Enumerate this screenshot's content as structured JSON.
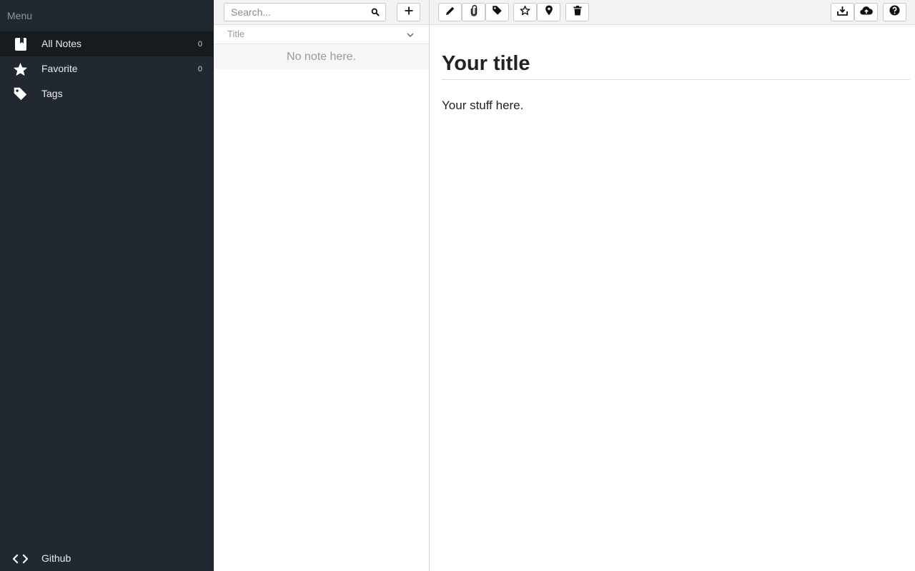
{
  "sidebar": {
    "menu_label": "Menu",
    "items": [
      {
        "label": "All Notes",
        "count": "0",
        "icon": "notebook-icon"
      },
      {
        "label": "Favorite",
        "count": "0",
        "icon": "star-icon"
      },
      {
        "label": "Tags",
        "icon": "tag-icon"
      }
    ],
    "bottom_item": {
      "label": "Github",
      "icon": "code-icon"
    }
  },
  "list": {
    "search_placeholder": "Search...",
    "sort_label": "Title",
    "empty_message": "No note here."
  },
  "editor": {
    "title_placeholder": "Your title",
    "body_placeholder": "Your stuff here."
  },
  "toolbar_icons": [
    "pencil-icon",
    "paperclip-icon",
    "tag-icon",
    "star-outline-icon",
    "map-pin-icon",
    "trash-icon",
    "download-icon",
    "cloud-upload-icon",
    "help-icon"
  ],
  "colors": {
    "sidebar_bg": "#212830",
    "sidebar_active": "#161b20",
    "toolbar_bg": "#f2f2f2"
  }
}
